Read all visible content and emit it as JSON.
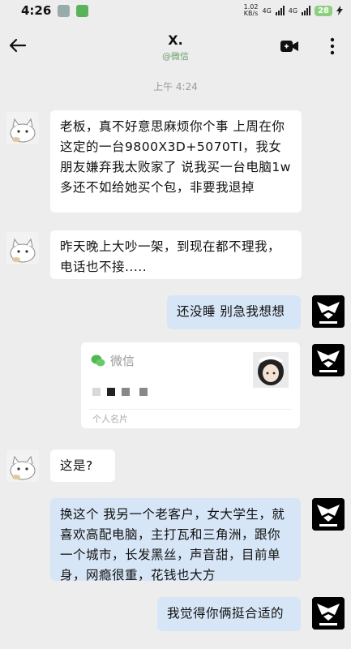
{
  "status_bar": {
    "time": "4:26",
    "net_speed": "1.02",
    "net_unit": "KB/s",
    "net_type_1": "4G",
    "net_type_2": "4G",
    "battery": "28"
  },
  "header": {
    "title": "X.",
    "subtitle": "@微信"
  },
  "timestamp": "上午 4:24",
  "messages": [
    {
      "side": "in",
      "text": "老板，真不好意思麻烦你个事 上周在你这定的一台9800X3D+5070TI，我女朋友嫌弃我太败家了 说我买一台电脑1w多还不如给她买个包，非要我退掉"
    },
    {
      "side": "in",
      "text": "昨天晚上大吵一架，到现在都不理我，电话也不接....."
    },
    {
      "side": "out",
      "text": "还没睡 别急我想想"
    },
    {
      "side": "out",
      "type": "contact_card",
      "app": "微信",
      "label": "个人名片"
    },
    {
      "side": "in",
      "text": "这是?"
    },
    {
      "side": "out",
      "text": "换这个 我另一个老客户，女大学生，就喜欢高配电脑，主打瓦和三角洲，跟你一个城市，长发黑丝，声音甜，目前单身，网瘾很重，花钱也大方"
    },
    {
      "side": "out",
      "text": "我觉得你俩挺合适的"
    }
  ],
  "icons": {
    "back": "arrow-left-icon",
    "video": "video-call-icon",
    "more": "more-vertical-icon",
    "wechat": "wechat-icon"
  },
  "colors": {
    "background": "#ededed",
    "incoming_bubble": "#ffffff",
    "outgoing_bubble": "#d7e6f7",
    "subtitle": "#6c9e6c"
  }
}
